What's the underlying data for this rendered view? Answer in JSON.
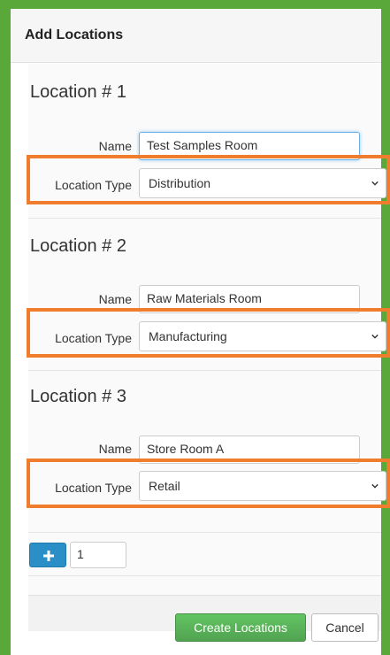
{
  "dialog": {
    "title": "Add Locations"
  },
  "locations": [
    {
      "heading": "Location # 1",
      "name_label": "Name",
      "name_value": "Test Samples Room",
      "type_label": "Location Type",
      "type_value": "Distribution"
    },
    {
      "heading": "Location # 2",
      "name_label": "Name",
      "name_value": "Raw Materials Room",
      "type_label": "Location Type",
      "type_value": "Manufacturing"
    },
    {
      "heading": "Location # 3",
      "name_label": "Name",
      "name_value": "Store Room A",
      "type_label": "Location Type",
      "type_value": "Retail"
    }
  ],
  "add_row": {
    "plus_icon": "plus-icon",
    "count_value": "1"
  },
  "actions": {
    "create_label": "Create Locations",
    "cancel_label": "Cancel"
  },
  "colors": {
    "frame_green": "#5aa83a",
    "highlight_orange": "#ef7d2d",
    "primary_blue": "#2b8fc7",
    "success_green": "#51a351"
  }
}
